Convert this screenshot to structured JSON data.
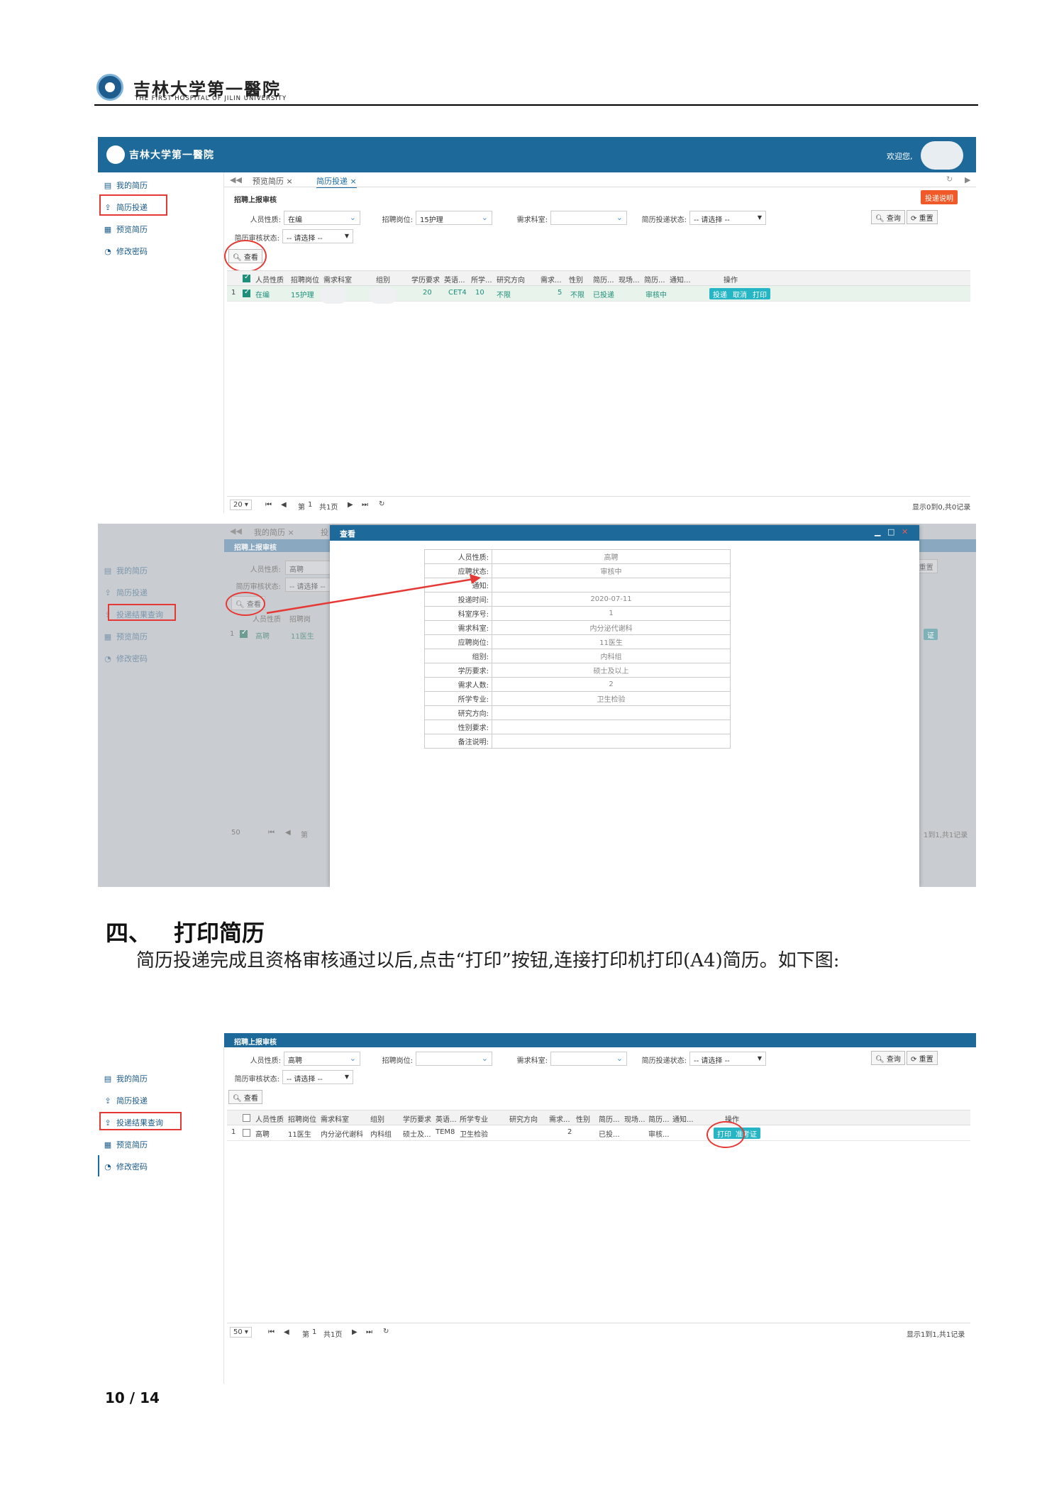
{
  "header": {
    "hospital_name": "吉林大学第一醫院",
    "hospital_en": "THE FIRST HOSPITAL OF JILIN UNIVERSITY"
  },
  "shot1": {
    "app_title": "吉林大学第一醫院",
    "welcome": "欢迎您,",
    "sidebar": [
      "我的简历",
      "简历投递",
      "预览简历",
      "修改密码"
    ],
    "tabs": [
      "预览简历 ×",
      "简历投递 ×"
    ],
    "panel_title": "招聘上报审核",
    "help_button": "投递说明",
    "filters": {
      "person_type_label": "人员性质:",
      "person_type_value": "在编",
      "post_label": "招聘岗位:",
      "post_value": "15护理",
      "dept_label": "需求科室:",
      "delivery_label": "简历投递状态:",
      "delivery_value": "-- 请选择 --",
      "review_label": "简历审核状态:",
      "review_value": "-- 请选择 --"
    },
    "search_btn": "查询",
    "reset_btn": "重置",
    "view_btn": "查看",
    "columns": [
      "人员性质",
      "招聘岗位",
      "需求科室",
      "组别",
      "学历要求",
      "英语...",
      "所学...",
      "研究方向",
      "需求...",
      "性别",
      "简历...",
      "现场...",
      "简历...",
      "通知...",
      "操作"
    ],
    "row": {
      "no": "1",
      "type": "在编",
      "post": "15护理",
      "edu": "20",
      "eng": "CET4",
      "major": "10",
      "research": "不限",
      "need": "5",
      "gender": "不限",
      "resume": "已投递",
      "status": "审核中"
    },
    "row_actions": [
      "投递",
      "取消",
      "打印"
    ],
    "pager": {
      "size": "20",
      "page_label": "第",
      "page": "1",
      "total": "共1页",
      "info": "显示0到0,共0记录"
    }
  },
  "shot2": {
    "sidebar": [
      "我的简历",
      "简历投递",
      "投递结果查询",
      "预览简历",
      "修改密码"
    ],
    "bg_tabs": [
      "我的简历 ×",
      "投"
    ],
    "panel_title": "招聘上报审核",
    "person_type_label": "人员性质:",
    "person_type_value": "高聘",
    "review_label": "简历审核状态:",
    "review_value": "-- 请选择 --",
    "view_btn": "查看",
    "col1": "人员性质",
    "col2": "招聘岗",
    "row": {
      "no": "1",
      "type": "高聘",
      "post": "11医生"
    },
    "reset_btn": "重置",
    "row_btn": "证",
    "pager": {
      "size": "50",
      "page_label": "第",
      "info": "1到1,共1记录"
    },
    "dialog_title": "查看",
    "fields": [
      {
        "k": "人员性质:",
        "v": "高聘"
      },
      {
        "k": "应聘状态:",
        "v": "审核中"
      },
      {
        "k": "通知:",
        "v": ""
      },
      {
        "k": "投递时间:",
        "v": "2020-07-11"
      },
      {
        "k": "科室序号:",
        "v": "1"
      },
      {
        "k": "需求科室:",
        "v": "内分泌代谢科"
      },
      {
        "k": "应聘岗位:",
        "v": "11医生"
      },
      {
        "k": "组别:",
        "v": "内科组"
      },
      {
        "k": "学历要求:",
        "v": "硕士及以上"
      },
      {
        "k": "需求人数:",
        "v": "2"
      },
      {
        "k": "所学专业:",
        "v": "卫生检验"
      },
      {
        "k": "研究方向:",
        "v": ""
      },
      {
        "k": "性别要求:",
        "v": ""
      },
      {
        "k": "备注说明:",
        "v": ""
      }
    ]
  },
  "section": {
    "number": "四、",
    "title": "打印简历"
  },
  "paragraph": "简历投递完成且资格审核通过以后,点击“打印”按钮,连接打印机打印(A4)简历。如下图:",
  "shot3": {
    "panel_title": "招聘上报审核",
    "sidebar": [
      "我的简历",
      "简历投递",
      "投递结果查询",
      "预览简历",
      "修改密码"
    ],
    "filters": {
      "person_type_label": "人员性质:",
      "person_type_value": "高聘",
      "post_label": "招聘岗位:",
      "dept_label": "需求科室:",
      "delivery_label": "简历投递状态:",
      "delivery_value": "-- 请选择 --",
      "review_label": "简历审核状态:",
      "review_value": "-- 请选择 --"
    },
    "search_btn": "查询",
    "reset_btn": "重置",
    "view_btn": "查看",
    "columns": [
      "人员性质",
      "招聘岗位",
      "需求科室",
      "组别",
      "学历要求",
      "英语...",
      "所学专业",
      "研究方向",
      "需求...",
      "性别",
      "简历...",
      "现场...",
      "简历...",
      "通知...",
      "操作"
    ],
    "row": {
      "no": "1",
      "type": "高聘",
      "post": "11医生",
      "dept": "内分泌代谢科",
      "group": "内科组",
      "edu": "硕士及...",
      "eng": "TEM8",
      "major": "卫生检验",
      "need": "2",
      "resume": "已投...",
      "status": "审核..."
    },
    "row_actions": [
      "打印",
      "准考证"
    ],
    "pager": {
      "size": "50",
      "page_label": "第",
      "page": "1",
      "total": "共1页",
      "info": "显示1到1,共1记录"
    }
  },
  "page_number": "10 / 14"
}
